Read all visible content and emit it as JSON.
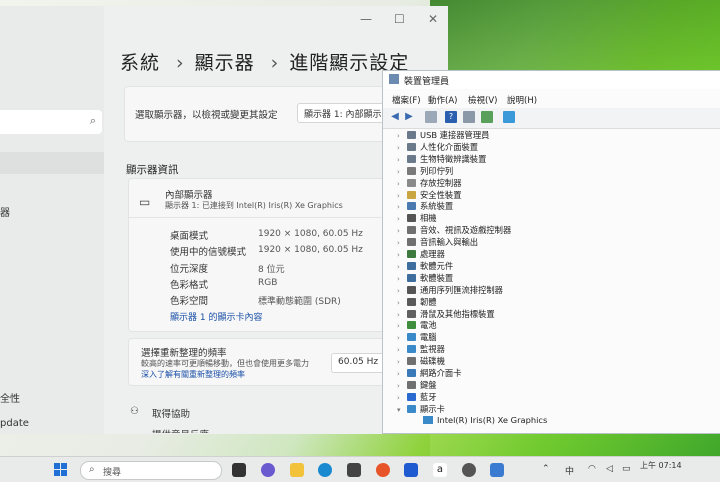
{
  "settings": {
    "breadcrumb": [
      "系統",
      "顯示器",
      "進階顯示設定"
    ],
    "select_prompt": "選取顯示器，以檢視或變更其設定",
    "display_dropdown": "顯示器 1: 內部顯示",
    "nav_fragments": [
      "器",
      "全性",
      "pdate"
    ],
    "section_title": "顯示器資訊",
    "display_name": "內部顯示器",
    "display_sub": "顯示器 1: 已連接到 Intel(R) Iris(R) Xe Graphics",
    "info_rows": [
      {
        "label": "桌面模式",
        "value": "1920 × 1080, 60.05 Hz"
      },
      {
        "label": "使用中的信號模式",
        "value": "1920 × 1080, 60.05 Hz"
      },
      {
        "label": "位元深度",
        "value": "8 位元"
      },
      {
        "label": "色彩格式",
        "value": "RGB"
      },
      {
        "label": "色彩空間",
        "value": "標準動態範圍 (SDR)"
      }
    ],
    "adapter_link": "顯示器 1 的顯示卡內容",
    "refresh_title": "選擇重新整理的頻率",
    "refresh_desc": "較高的速率可更順暢移動，但也會使用更多電力",
    "refresh_link": "深入了解有關重新整理的頻率",
    "refresh_value": "60.05 Hz",
    "help": "取得協助",
    "feedback_partial": "提供意見反應"
  },
  "devmgr": {
    "title": "裝置管理員",
    "menu": [
      "檔案(F)",
      "動作(A)",
      "檢視(V)",
      "說明(H)"
    ],
    "tree": [
      {
        "label": "USB 連接器管理員",
        "color": "#6a7a8a"
      },
      {
        "label": "人性化介面裝置",
        "color": "#6a7a8a"
      },
      {
        "label": "生物特徵辨識裝置",
        "color": "#6a7a8a"
      },
      {
        "label": "列印佇列",
        "color": "#7a7a7a"
      },
      {
        "label": "存放控制器",
        "color": "#8a8a8a"
      },
      {
        "label": "安全性裝置",
        "color": "#c9a640"
      },
      {
        "label": "系統裝置",
        "color": "#4a7ab0"
      },
      {
        "label": "相機",
        "color": "#555555"
      },
      {
        "label": "音效、視訊及遊戲控制器",
        "color": "#707070"
      },
      {
        "label": "音訊輸入與輸出",
        "color": "#707070"
      },
      {
        "label": "處理器",
        "color": "#3e7a3e"
      },
      {
        "label": "軟體元件",
        "color": "#3e6e9e"
      },
      {
        "label": "軟體裝置",
        "color": "#3e6e9e"
      },
      {
        "label": "通用序列匯流排控制器",
        "color": "#555555"
      },
      {
        "label": "韌體",
        "color": "#5a5a5a"
      },
      {
        "label": "滑鼠及其他指標裝置",
        "color": "#606060"
      },
      {
        "label": "電池",
        "color": "#3e8e3e"
      },
      {
        "label": "電腦",
        "color": "#3a8ac9"
      },
      {
        "label": "監視器",
        "color": "#3a8ac9"
      },
      {
        "label": "磁碟機",
        "color": "#707070"
      },
      {
        "label": "網路介面卡",
        "color": "#3a7ab9"
      },
      {
        "label": "鍵盤",
        "color": "#707070"
      },
      {
        "label": "藍牙",
        "color": "#2a6ad0"
      },
      {
        "label": "顯示卡",
        "color": "#3a8ac9"
      }
    ],
    "child": "Intel(R) Iris(R) Xe Graphics"
  },
  "taskbar": {
    "search": "搜尋",
    "ime": "中",
    "time": "07:14",
    "ampm": "上午"
  }
}
